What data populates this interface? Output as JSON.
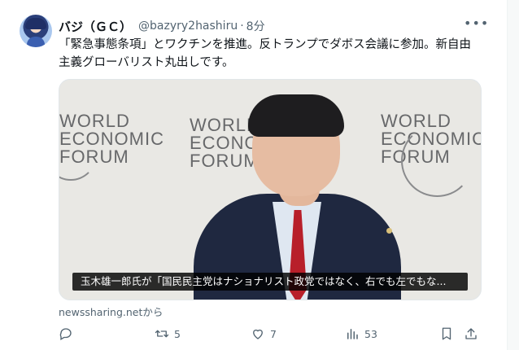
{
  "tweet": {
    "display_name": "バジ（ＧＣ）",
    "handle": "@bazyry2hashiru",
    "separator": "·",
    "time": "8分",
    "more_icon": "ellipsis-icon",
    "text": "「緊急事態条項」とワクチンを推進。反トランプでダボス会議に参加。新自由主義グローバリスト丸出しです。"
  },
  "media": {
    "backdrop_lines": [
      "WORLD",
      "ECONOMIC",
      "FORUM"
    ],
    "caption": "玉木雄一郎氏が「国民民主党はナショナリスト政党ではなく、右でも左でもな..."
  },
  "source": "newssharing.netから",
  "actions": {
    "reply": {
      "icon": "reply-icon",
      "count": ""
    },
    "retweet": {
      "icon": "retweet-icon",
      "count": "5"
    },
    "like": {
      "icon": "heart-icon",
      "count": "7"
    },
    "views": {
      "icon": "views-icon",
      "count": "53"
    },
    "bookmark": {
      "icon": "bookmark-icon"
    },
    "share": {
      "icon": "share-icon"
    }
  },
  "colors": {
    "text": "#0f1419",
    "muted": "#536471",
    "caption_bg": "#000000"
  }
}
